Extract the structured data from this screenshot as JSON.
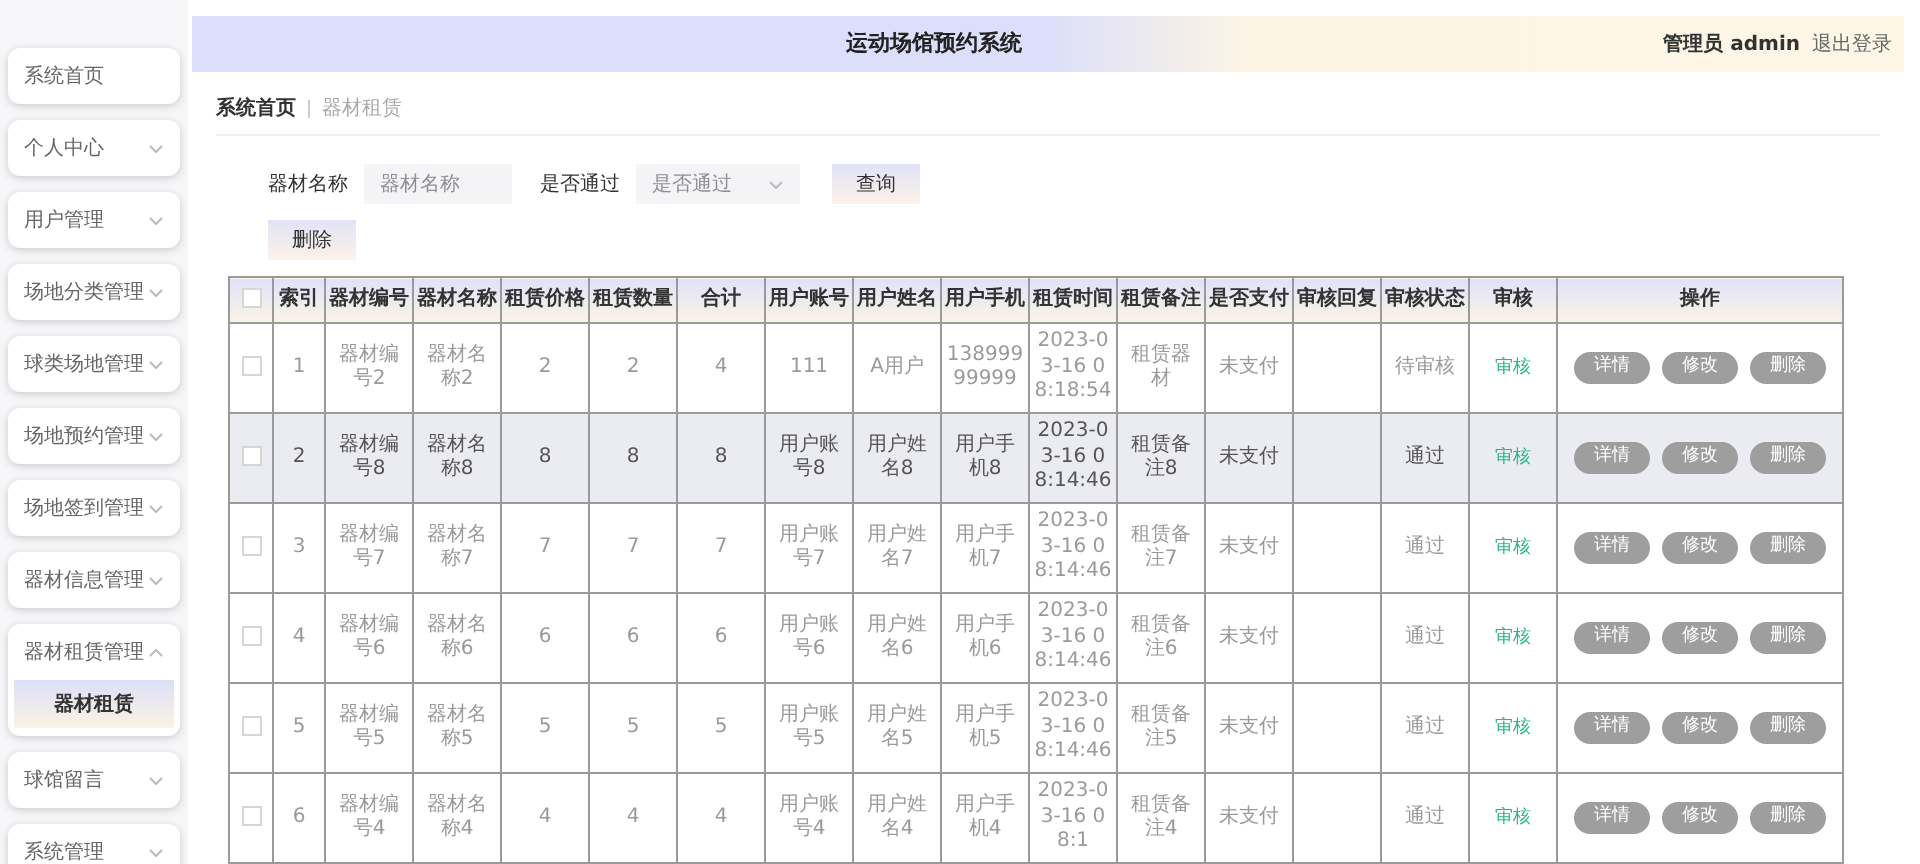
{
  "sidebar": {
    "items": [
      {
        "label": "系统首页",
        "kind": "link"
      },
      {
        "label": "个人中心",
        "kind": "menu",
        "expanded": false
      },
      {
        "label": "用户管理",
        "kind": "menu",
        "expanded": false
      },
      {
        "label": "场地分类管理",
        "kind": "menu",
        "expanded": false
      },
      {
        "label": "球类场地管理",
        "kind": "menu",
        "expanded": false
      },
      {
        "label": "场地预约管理",
        "kind": "menu",
        "expanded": false
      },
      {
        "label": "场地签到管理",
        "kind": "menu",
        "expanded": false
      },
      {
        "label": "器材信息管理",
        "kind": "menu",
        "expanded": false
      },
      {
        "label": "器材租赁管理",
        "kind": "menu",
        "expanded": true,
        "children": [
          {
            "label": "器材租赁",
            "selected": true
          }
        ]
      },
      {
        "label": "球馆留言",
        "kind": "menu",
        "expanded": false
      },
      {
        "label": "系统管理",
        "kind": "menu",
        "expanded": false
      }
    ]
  },
  "header": {
    "title": "运动场馆预约系统",
    "user": "管理员 admin",
    "logout": "退出登录"
  },
  "breadcrumb": [
    "系统首页",
    "器材租赁"
  ],
  "filters": {
    "name_label": "器材名称",
    "name_placeholder": "器材名称",
    "pass_label": "是否通过",
    "pass_placeholder": "是否通过",
    "search_button": "查询",
    "delete_button": "删除"
  },
  "table": {
    "header_checked": false,
    "columns": [
      "索引",
      "器材编号",
      "器材名称",
      "租赁价格",
      "租赁数量",
      "合计",
      "用户账号",
      "用户姓名",
      "用户手机",
      "租赁时间",
      "租赁备注",
      "是否支付",
      "审核回复",
      "审核状态",
      "审核",
      "操作"
    ],
    "rows": [
      {
        "selected": false,
        "checked": false,
        "cells": [
          "1",
          "器材编号2",
          "器材名称2",
          "2",
          "2",
          "4",
          "111",
          "A用户",
          "13899999999",
          "2023-03-16 08:18:54",
          "租赁器材",
          "未支付",
          null,
          "待审核"
        ],
        "review": "审核",
        "actions": [
          "详情",
          "修改",
          "删除"
        ]
      },
      {
        "selected": true,
        "checked": false,
        "cells": [
          "2",
          "器材编号8",
          "器材名称8",
          "8",
          "8",
          "8",
          "用户账号8",
          "用户姓名8",
          "用户手机8",
          "2023-03-16 08:14:46",
          "租赁备注8",
          "未支付",
          null,
          "通过"
        ],
        "review": "审核",
        "actions": [
          "详情",
          "修改",
          "删除"
        ]
      },
      {
        "selected": false,
        "checked": false,
        "cells": [
          "3",
          "器材编号7",
          "器材名称7",
          "7",
          "7",
          "7",
          "用户账号7",
          "用户姓名7",
          "用户手机7",
          "2023-03-16 08:14:46",
          "租赁备注7",
          "未支付",
          null,
          "通过"
        ],
        "review": "审核",
        "actions": [
          "详情",
          "修改",
          "删除"
        ]
      },
      {
        "selected": false,
        "checked": false,
        "cells": [
          "4",
          "器材编号6",
          "器材名称6",
          "6",
          "6",
          "6",
          "用户账号6",
          "用户姓名6",
          "用户手机6",
          "2023-03-16 08:14:46",
          "租赁备注6",
          "未支付",
          null,
          "通过"
        ],
        "review": "审核",
        "actions": [
          "详情",
          "修改",
          "删除"
        ]
      },
      {
        "selected": false,
        "checked": false,
        "cells": [
          "5",
          "器材编号5",
          "器材名称5",
          "5",
          "5",
          "5",
          "用户账号5",
          "用户姓名5",
          "用户手机5",
          "2023-03-16 08:14:46",
          "租赁备注5",
          "未支付",
          null,
          "通过"
        ],
        "review": "审核",
        "actions": [
          "详情",
          "修改",
          "删除"
        ]
      },
      {
        "selected": false,
        "checked": false,
        "cells": [
          "6",
          "器材编号4",
          "器材名称4",
          "4",
          "4",
          "4",
          "用户账号4",
          "用户姓名4",
          "用户手机4",
          "2023-03-16 08:1",
          "租赁备注4",
          "未支付",
          null,
          "通过"
        ],
        "review": "审核",
        "actions": [
          "详情",
          "修改",
          "删除"
        ]
      }
    ]
  }
}
